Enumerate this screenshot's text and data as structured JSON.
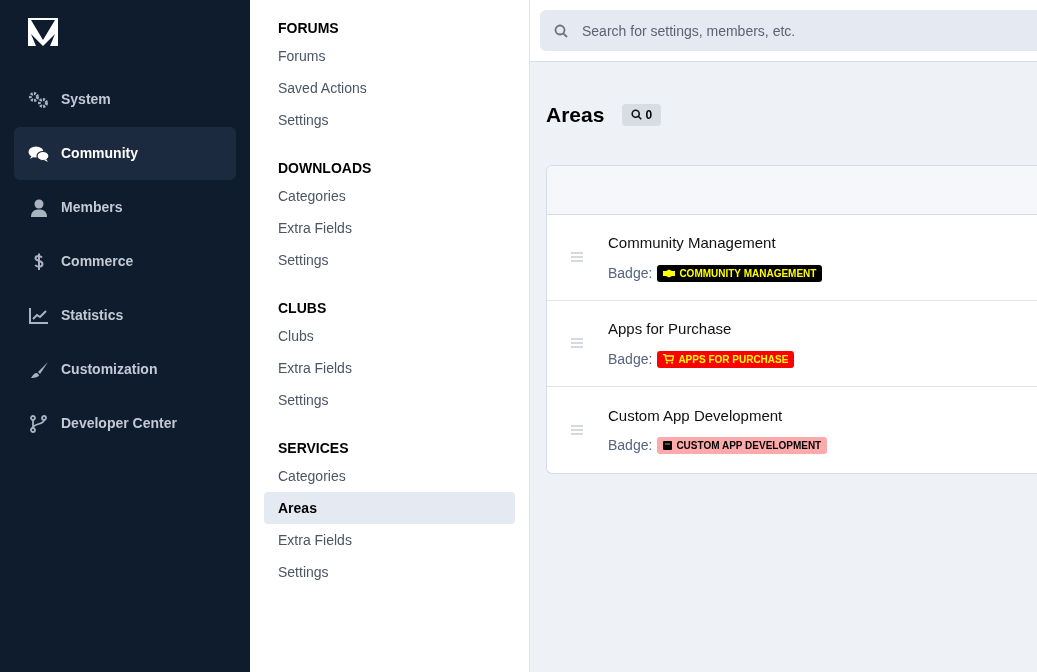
{
  "nav": [
    {
      "label": "System",
      "selected": false
    },
    {
      "label": "Community",
      "selected": true
    },
    {
      "label": "Members",
      "selected": false
    },
    {
      "label": "Commerce",
      "selected": false
    },
    {
      "label": "Statistics",
      "selected": false
    },
    {
      "label": "Customization",
      "selected": false
    },
    {
      "label": "Developer Center",
      "selected": false
    }
  ],
  "subnav": [
    {
      "heading": "FORUMS",
      "items": [
        {
          "label": "Forums",
          "selected": false
        },
        {
          "label": "Saved Actions",
          "selected": false
        },
        {
          "label": "Settings",
          "selected": false
        }
      ]
    },
    {
      "heading": "DOWNLOADS",
      "items": [
        {
          "label": "Categories",
          "selected": false
        },
        {
          "label": "Extra Fields",
          "selected": false
        },
        {
          "label": "Settings",
          "selected": false
        }
      ]
    },
    {
      "heading": "CLUBS",
      "items": [
        {
          "label": "Clubs",
          "selected": false
        },
        {
          "label": "Extra Fields",
          "selected": false
        },
        {
          "label": "Settings",
          "selected": false
        }
      ]
    },
    {
      "heading": "SERVICES",
      "items": [
        {
          "label": "Categories",
          "selected": false
        },
        {
          "label": "Areas",
          "selected": true
        },
        {
          "label": "Extra Fields",
          "selected": false
        },
        {
          "label": "Settings",
          "selected": false
        }
      ]
    }
  ],
  "search": {
    "placeholder": "Search for settings, members, etc."
  },
  "page": {
    "title": "Areas",
    "count": "0"
  },
  "areas": [
    {
      "name": "Community Management",
      "badge_label": "Badge:",
      "badge": "COMMUNITY MANAGEMENT",
      "color": "#000000"
    },
    {
      "name": "Apps for Purchase",
      "badge_label": "Badge:",
      "badge": "APPS FOR PURCHASE",
      "color": "#ff0000"
    },
    {
      "name": "Custom App Development",
      "badge_label": "Badge:",
      "badge": "CUSTOM APP DEVELOPMENT",
      "color": "#ffaaaa"
    }
  ]
}
